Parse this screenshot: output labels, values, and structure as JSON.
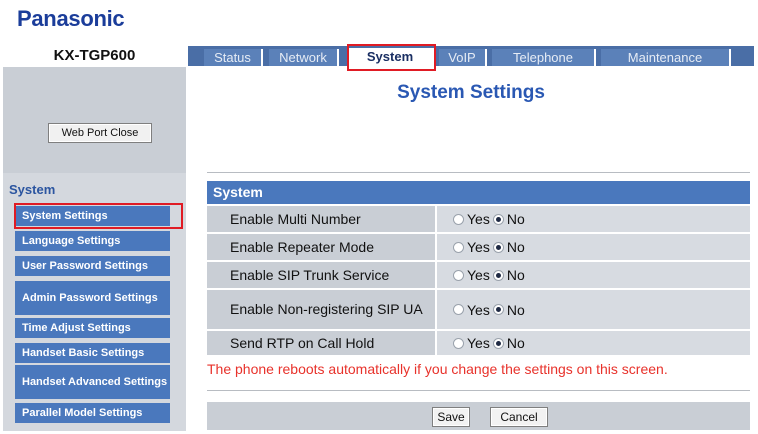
{
  "brand": {
    "logo_text": "Panasonic"
  },
  "model": "KX-TGP600",
  "tabs": [
    {
      "label": "Status",
      "active": false
    },
    {
      "label": "Network",
      "active": false
    },
    {
      "label": "System",
      "active": true
    },
    {
      "label": "VoIP",
      "active": false
    },
    {
      "label": "Telephone",
      "active": false
    },
    {
      "label": "Maintenance",
      "active": false
    }
  ],
  "sidebar": {
    "web_port_close_label": "Web Port Close",
    "heading": "System",
    "items": [
      {
        "label": "System Settings",
        "selected": true
      },
      {
        "label": "Language Settings",
        "selected": false
      },
      {
        "label": "User Password Settings",
        "selected": false
      },
      {
        "label": "Admin Password Settings",
        "selected": false
      },
      {
        "label": "Time Adjust Settings",
        "selected": false
      },
      {
        "label": "Handset Basic Settings",
        "selected": false
      },
      {
        "label": "Handset Advanced Settings",
        "selected": false
      },
      {
        "label": "Parallel Model Settings",
        "selected": false
      }
    ]
  },
  "main": {
    "title": "System Settings",
    "section_title": "System",
    "rows": [
      {
        "label": "Enable Multi Number",
        "yes_label": "Yes",
        "no_label": "No",
        "value": "No"
      },
      {
        "label": "Enable Repeater Mode",
        "yes_label": "Yes",
        "no_label": "No",
        "value": "No"
      },
      {
        "label": "Enable SIP Trunk Service",
        "yes_label": "Yes",
        "no_label": "No",
        "value": "No"
      },
      {
        "label": "Enable Non-registering SIP UA",
        "yes_label": "Yes",
        "no_label": "No",
        "value": "No"
      },
      {
        "label": "Send RTP on Call Hold",
        "yes_label": "Yes",
        "no_label": "No",
        "value": "No"
      }
    ],
    "warning": "The phone reboots automatically if you change the settings on this screen.",
    "save_label": "Save",
    "cancel_label": "Cancel"
  },
  "colors": {
    "brand_blue": "#1b3d9a",
    "tab_bar": "#4a6ea6",
    "accent_blue": "#4a78bd",
    "highlight_red": "#e01b24",
    "warning_red": "#e8322b"
  }
}
